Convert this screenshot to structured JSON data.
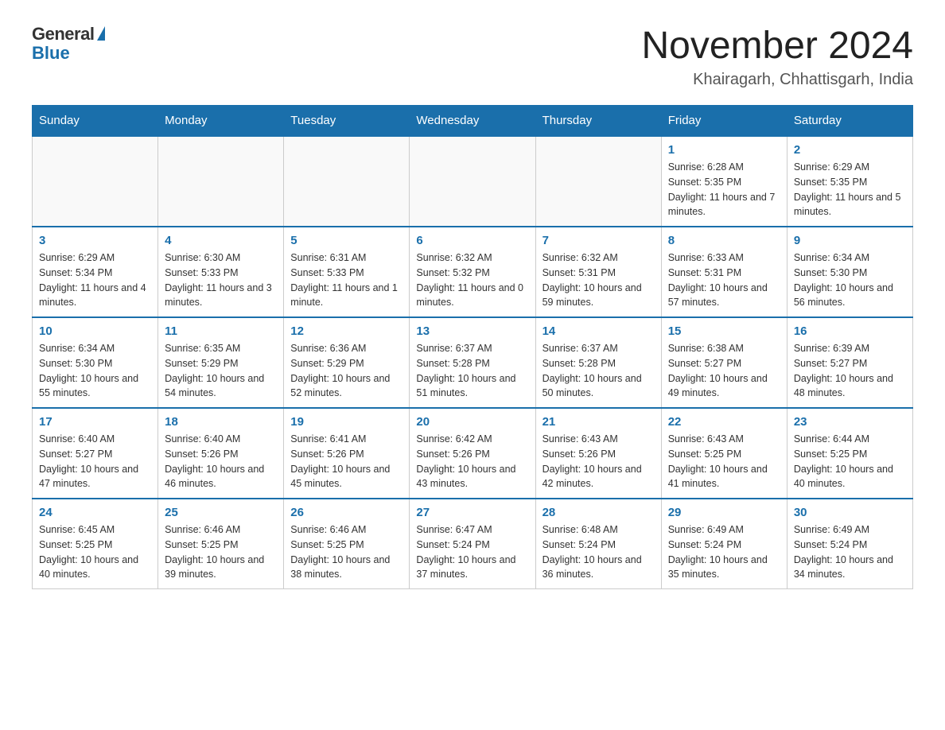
{
  "header": {
    "logo_general": "General",
    "logo_blue": "Blue",
    "month_title": "November 2024",
    "location": "Khairagarh, Chhattisgarh, India"
  },
  "days_of_week": [
    "Sunday",
    "Monday",
    "Tuesday",
    "Wednesday",
    "Thursday",
    "Friday",
    "Saturday"
  ],
  "weeks": [
    [
      {
        "day": "",
        "info": ""
      },
      {
        "day": "",
        "info": ""
      },
      {
        "day": "",
        "info": ""
      },
      {
        "day": "",
        "info": ""
      },
      {
        "day": "",
        "info": ""
      },
      {
        "day": "1",
        "info": "Sunrise: 6:28 AM\nSunset: 5:35 PM\nDaylight: 11 hours and 7 minutes."
      },
      {
        "day": "2",
        "info": "Sunrise: 6:29 AM\nSunset: 5:35 PM\nDaylight: 11 hours and 5 minutes."
      }
    ],
    [
      {
        "day": "3",
        "info": "Sunrise: 6:29 AM\nSunset: 5:34 PM\nDaylight: 11 hours and 4 minutes."
      },
      {
        "day": "4",
        "info": "Sunrise: 6:30 AM\nSunset: 5:33 PM\nDaylight: 11 hours and 3 minutes."
      },
      {
        "day": "5",
        "info": "Sunrise: 6:31 AM\nSunset: 5:33 PM\nDaylight: 11 hours and 1 minute."
      },
      {
        "day": "6",
        "info": "Sunrise: 6:32 AM\nSunset: 5:32 PM\nDaylight: 11 hours and 0 minutes."
      },
      {
        "day": "7",
        "info": "Sunrise: 6:32 AM\nSunset: 5:31 PM\nDaylight: 10 hours and 59 minutes."
      },
      {
        "day": "8",
        "info": "Sunrise: 6:33 AM\nSunset: 5:31 PM\nDaylight: 10 hours and 57 minutes."
      },
      {
        "day": "9",
        "info": "Sunrise: 6:34 AM\nSunset: 5:30 PM\nDaylight: 10 hours and 56 minutes."
      }
    ],
    [
      {
        "day": "10",
        "info": "Sunrise: 6:34 AM\nSunset: 5:30 PM\nDaylight: 10 hours and 55 minutes."
      },
      {
        "day": "11",
        "info": "Sunrise: 6:35 AM\nSunset: 5:29 PM\nDaylight: 10 hours and 54 minutes."
      },
      {
        "day": "12",
        "info": "Sunrise: 6:36 AM\nSunset: 5:29 PM\nDaylight: 10 hours and 52 minutes."
      },
      {
        "day": "13",
        "info": "Sunrise: 6:37 AM\nSunset: 5:28 PM\nDaylight: 10 hours and 51 minutes."
      },
      {
        "day": "14",
        "info": "Sunrise: 6:37 AM\nSunset: 5:28 PM\nDaylight: 10 hours and 50 minutes."
      },
      {
        "day": "15",
        "info": "Sunrise: 6:38 AM\nSunset: 5:27 PM\nDaylight: 10 hours and 49 minutes."
      },
      {
        "day": "16",
        "info": "Sunrise: 6:39 AM\nSunset: 5:27 PM\nDaylight: 10 hours and 48 minutes."
      }
    ],
    [
      {
        "day": "17",
        "info": "Sunrise: 6:40 AM\nSunset: 5:27 PM\nDaylight: 10 hours and 47 minutes."
      },
      {
        "day": "18",
        "info": "Sunrise: 6:40 AM\nSunset: 5:26 PM\nDaylight: 10 hours and 46 minutes."
      },
      {
        "day": "19",
        "info": "Sunrise: 6:41 AM\nSunset: 5:26 PM\nDaylight: 10 hours and 45 minutes."
      },
      {
        "day": "20",
        "info": "Sunrise: 6:42 AM\nSunset: 5:26 PM\nDaylight: 10 hours and 43 minutes."
      },
      {
        "day": "21",
        "info": "Sunrise: 6:43 AM\nSunset: 5:26 PM\nDaylight: 10 hours and 42 minutes."
      },
      {
        "day": "22",
        "info": "Sunrise: 6:43 AM\nSunset: 5:25 PM\nDaylight: 10 hours and 41 minutes."
      },
      {
        "day": "23",
        "info": "Sunrise: 6:44 AM\nSunset: 5:25 PM\nDaylight: 10 hours and 40 minutes."
      }
    ],
    [
      {
        "day": "24",
        "info": "Sunrise: 6:45 AM\nSunset: 5:25 PM\nDaylight: 10 hours and 40 minutes."
      },
      {
        "day": "25",
        "info": "Sunrise: 6:46 AM\nSunset: 5:25 PM\nDaylight: 10 hours and 39 minutes."
      },
      {
        "day": "26",
        "info": "Sunrise: 6:46 AM\nSunset: 5:25 PM\nDaylight: 10 hours and 38 minutes."
      },
      {
        "day": "27",
        "info": "Sunrise: 6:47 AM\nSunset: 5:24 PM\nDaylight: 10 hours and 37 minutes."
      },
      {
        "day": "28",
        "info": "Sunrise: 6:48 AM\nSunset: 5:24 PM\nDaylight: 10 hours and 36 minutes."
      },
      {
        "day": "29",
        "info": "Sunrise: 6:49 AM\nSunset: 5:24 PM\nDaylight: 10 hours and 35 minutes."
      },
      {
        "day": "30",
        "info": "Sunrise: 6:49 AM\nSunset: 5:24 PM\nDaylight: 10 hours and 34 minutes."
      }
    ]
  ]
}
